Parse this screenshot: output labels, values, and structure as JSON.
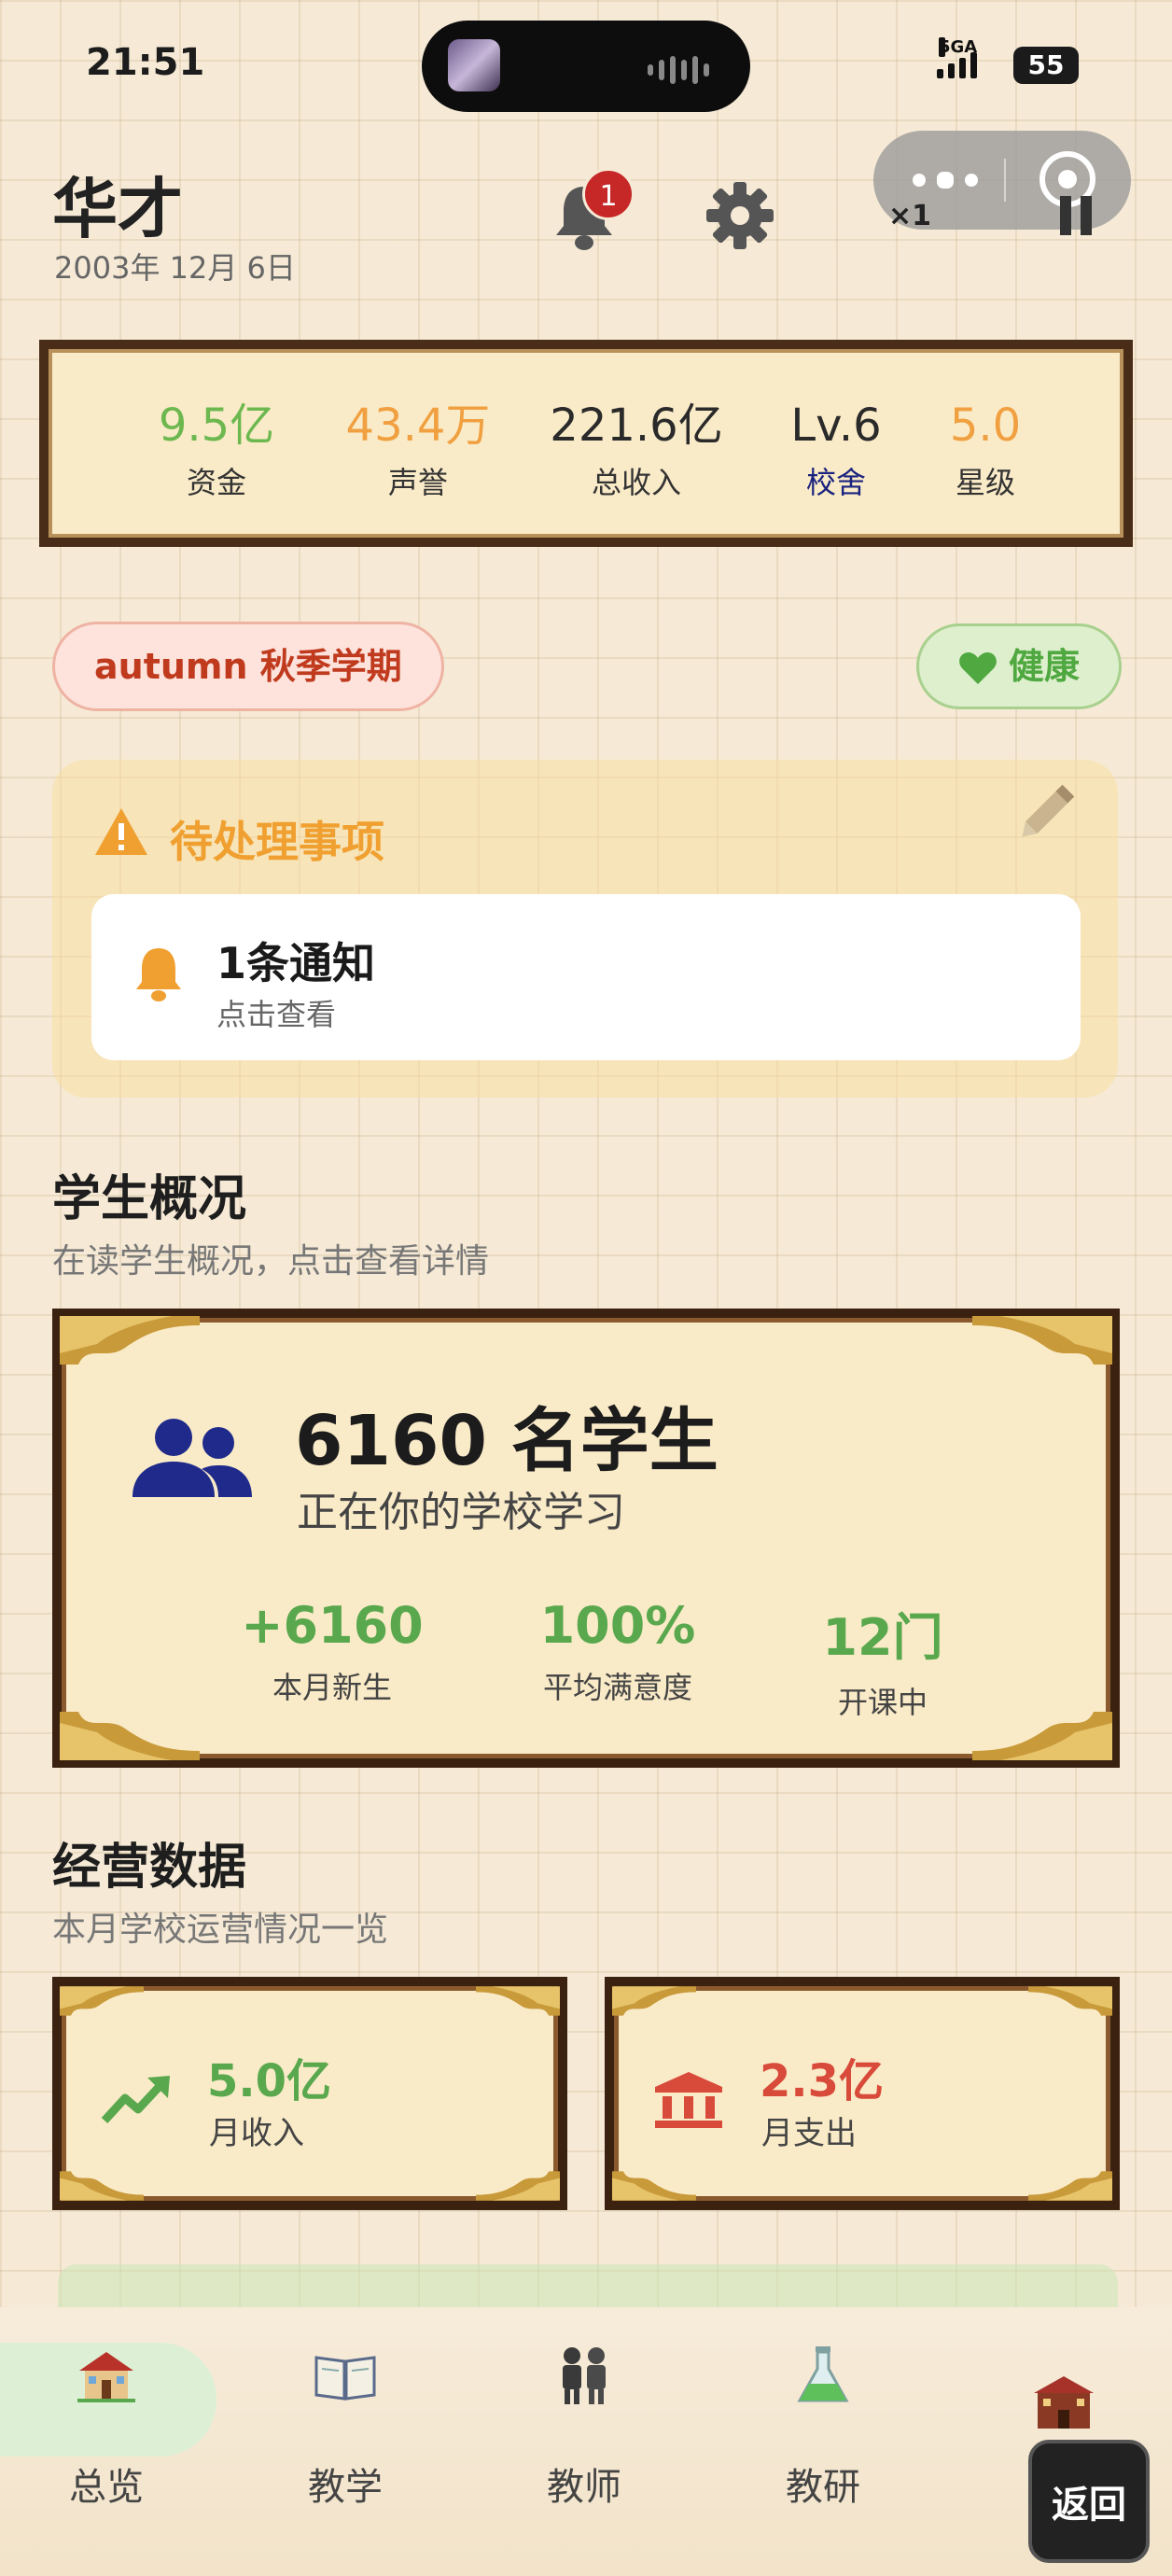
{
  "status_bar": {
    "time": "21:51",
    "network": "5GA",
    "battery": "55"
  },
  "capsule": {
    "speed": "×1"
  },
  "header": {
    "school_name": "华才",
    "date": "2003年 12月 6日",
    "notification_count": "1"
  },
  "stats": {
    "funds": {
      "value": "9.5亿",
      "label": "资金",
      "color": "#6cb84f"
    },
    "reputation": {
      "value": "43.4万",
      "label": "声誉",
      "color": "#f0a040"
    },
    "total_income": {
      "value": "221.6亿",
      "label": "总收入",
      "color": "#2a2a2a"
    },
    "dorm": {
      "value": "Lv.6",
      "label": "校舍",
      "label_color": "#1a237e"
    },
    "stars": {
      "value": "5.0",
      "label": "星级",
      "color": "#f0a040"
    }
  },
  "season": {
    "label": "autumn 秋季学期"
  },
  "health": {
    "label": "健康"
  },
  "pending": {
    "title": "待处理事项",
    "notice_title": "1条通知",
    "notice_sub": "点击查看"
  },
  "students_section": {
    "title": "学生概况",
    "subtitle": "在读学生概况，点击查看详情",
    "count": "6160 名学生",
    "sub": "正在你的学校学习",
    "metrics": [
      {
        "value": "+6160",
        "label": "本月新生"
      },
      {
        "value": "100%",
        "label": "平均满意度"
      },
      {
        "value": "12门",
        "label": "开课中"
      }
    ]
  },
  "business_section": {
    "title": "经营数据",
    "subtitle": "本月学校运营情况一览",
    "income": {
      "value": "5.0亿",
      "label": "月收入",
      "color": "#5aa84e"
    },
    "expense": {
      "value": "2.3亿",
      "label": "月支出",
      "color": "#d84a3a"
    }
  },
  "bottom_nav": {
    "items": [
      {
        "label": "总览",
        "icon": "school-house-icon",
        "active": true
      },
      {
        "label": "教学",
        "icon": "book-icon"
      },
      {
        "label": "教师",
        "icon": "teachers-icon"
      },
      {
        "label": "教研",
        "icon": "flask-icon"
      }
    ],
    "back_label": "返回"
  },
  "colors": {
    "accent_green": "#5aa84e",
    "accent_orange": "#f0a030",
    "frame_brown": "#3b2210",
    "paper": "#f6ead6"
  }
}
